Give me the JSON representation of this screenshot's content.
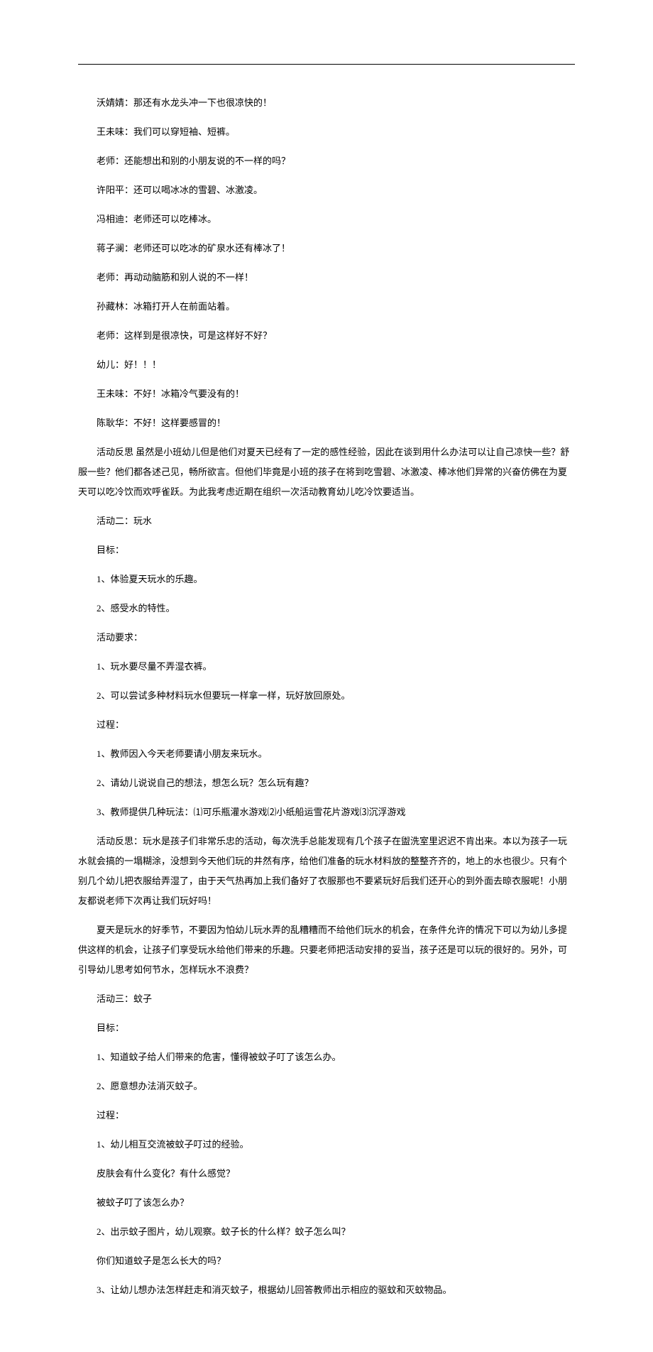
{
  "lines": [
    {
      "cls": "indent1",
      "t": "沃婧婧：那还有水龙头冲一下也很凉快的！"
    },
    {
      "cls": "indent1",
      "t": "王未味：我们可以穿短袖、短裤。"
    },
    {
      "cls": "indent1",
      "t": "老师：还能想出和别的小朋友说的不一样的吗？"
    },
    {
      "cls": "indent1",
      "t": "许阳平：还可以喝冰冰的雪碧、冰激凌。"
    },
    {
      "cls": "indent1",
      "t": "冯相迪：老师还可以吃棒冰。"
    },
    {
      "cls": "indent1",
      "t": "蒋子澜：老师还可以吃冰的矿泉水还有棒冰了！"
    },
    {
      "cls": "indent1",
      "t": "老师：再动动脑筋和别人说的不一样！"
    },
    {
      "cls": "indent1",
      "t": "孙藏林：冰箱打开人在前面站着。"
    },
    {
      "cls": "indent1",
      "t": "老师：这样到是很凉快，可是这样好不好？"
    },
    {
      "cls": "indent1",
      "t": "幼儿：好！！！"
    },
    {
      "cls": "indent1",
      "t": "王未味：不好！冰箱冷气要没有的！"
    },
    {
      "cls": "indent1",
      "t": "陈耿华：不好！这样要感冒的！"
    },
    {
      "cls": "indent1",
      "t": "活动反思 虽然是小班幼儿但是他们对夏天已经有了一定的感性经验，因此在谈到用什么办法可以让自己凉快一些？舒服一些？他们都各述己见，畅所欲言。但他们毕竟是小班的孩子在将到吃雪碧、冰激凌、棒冰他们异常的兴奋仿佛在为夏天可以吃冷饮而欢呼雀跃。为此我考虑近期在组织一次活动教育幼儿吃冷饮要适当。"
    },
    {
      "cls": "indent1",
      "t": "活动二：玩水"
    },
    {
      "cls": "indent1",
      "t": "目标："
    },
    {
      "cls": "indent1",
      "t": "1、体验夏天玩水的乐趣。"
    },
    {
      "cls": "indent1",
      "t": "2、感受水的特性。"
    },
    {
      "cls": "indent1",
      "t": "活动要求："
    },
    {
      "cls": "indent1",
      "t": "1、玩水要尽量不弄湿衣裤。"
    },
    {
      "cls": "indent1",
      "t": "2、可以尝试多种材料玩水但要玩一样拿一样，玩好放回原处。"
    },
    {
      "cls": "indent1",
      "t": "过程："
    },
    {
      "cls": "indent1",
      "t": "1、教师因入今天老师要请小朋友来玩水。"
    },
    {
      "cls": "indent1",
      "t": "2、请幼儿说说自己的想法，想怎么玩？怎么玩有趣？"
    },
    {
      "cls": "indent1",
      "t": "3、教师提供几种玩法：⑴可乐瓶灌水游戏⑵小纸船运雪花片游戏⑶沉浮游戏"
    },
    {
      "cls": "indent1",
      "t": "活动反思：玩水是孩子们非常乐忠的活动，每次洗手总能发现有几个孩子在盥洗室里迟迟不肯出来。本以为孩子一玩水就会搞的一塌糊涂，没想到今天他们玩的井然有序，给他们准备的玩水材料放的整整齐齐的，地上的水也很少。只有个别几个幼儿把衣服给弄湿了，由于天气热再加上我们备好了衣服那也不要紧玩好后我们还开心的到外面去晾衣服呢！小朋友都说老师下次再让我们玩好吗！"
    },
    {
      "cls": "indent1",
      "t": "夏天是玩水的好季节，不要因为怕幼儿玩水弄的乱糟糟而不给他们玩水的机会，在条件允许的情况下可以为幼儿多提供这样的机会，让孩子们享受玩水给他们带来的乐趣。只要老师把活动安排的妥当，孩子还是可以玩的很好的。另外，可引导幼儿思考如何节水，怎样玩水不浪费？"
    },
    {
      "cls": "indent1",
      "t": "活动三：蚊子"
    },
    {
      "cls": "indent1",
      "t": "目标："
    },
    {
      "cls": "indent1",
      "t": "1、知道蚊子给人们带来的危害，懂得被蚊子叮了该怎么办。"
    },
    {
      "cls": "indent1",
      "t": "2、愿意想办法消灭蚊子。"
    },
    {
      "cls": "indent1",
      "t": "过程："
    },
    {
      "cls": "indent1",
      "t": "1、幼儿相互交流被蚊子叮过的经验。"
    },
    {
      "cls": "indent1",
      "t": "皮肤会有什么变化？有什么感觉？"
    },
    {
      "cls": "indent1",
      "t": "被蚊子叮了该怎么办？"
    },
    {
      "cls": "indent1",
      "t": "2、出示蚊子图片，幼儿观察。蚊子长的什么样？蚊子怎么叫？"
    },
    {
      "cls": "indent1",
      "t": "你们知道蚊子是怎么长大的吗？"
    },
    {
      "cls": "indent1",
      "t": "3、让幼儿想办法怎样赶走和消灭蚊子，根据幼儿回答教师出示相应的驱蚊和灭蚊物品。"
    }
  ]
}
